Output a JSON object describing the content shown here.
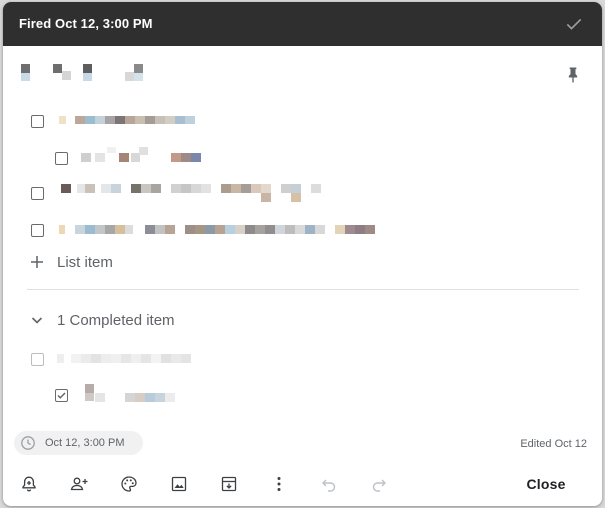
{
  "banner": {
    "text": "Fired Oct 12, 3:00 PM"
  },
  "list": {
    "add_item_label": "List item"
  },
  "completed": {
    "label": "1 Completed item"
  },
  "footer": {
    "reminder_chip": "Oct 12, 3:00 PM",
    "edited": "Edited Oct 12"
  },
  "toolbar": {
    "buttons": [
      "remind-me-icon",
      "collaborator-icon",
      "palette-icon",
      "image-icon",
      "archive-icon",
      "more-icon",
      "undo-icon",
      "redo-icon"
    ],
    "close_label": "Close"
  },
  "colors": {
    "banner_bg": "#2f2f2f",
    "card_bg": "#ffffff",
    "secondary_text": "#5f6368"
  }
}
